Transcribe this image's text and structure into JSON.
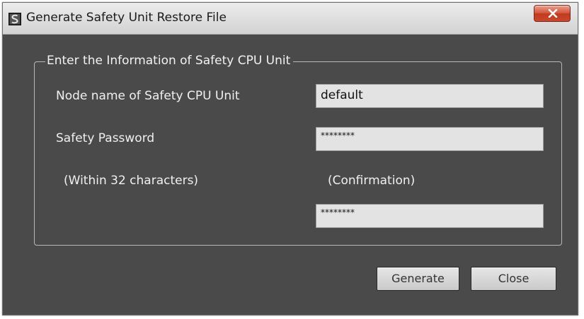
{
  "window": {
    "title": "Generate Safety Unit Restore File"
  },
  "group": {
    "legend": "Enter the Information of Safety CPU Unit"
  },
  "fields": {
    "node_name_label": "Node name of Safety CPU Unit",
    "node_name_value": "default",
    "password_label": "Safety Password",
    "password_value": "********",
    "password_hint": "(Within 32 characters)",
    "confirmation_label": "(Confirmation)",
    "confirmation_value": "********"
  },
  "buttons": {
    "generate": "Generate",
    "close": "Close"
  },
  "icons": {
    "app": "safety-app-icon",
    "close": "close-icon"
  },
  "colors": {
    "window_bg": "#4a4a4a",
    "titlebar_bg": "#dedede",
    "close_button": "#c9482c",
    "field_bg": "#e3e3e3",
    "text_light": "#f0f0f0"
  }
}
